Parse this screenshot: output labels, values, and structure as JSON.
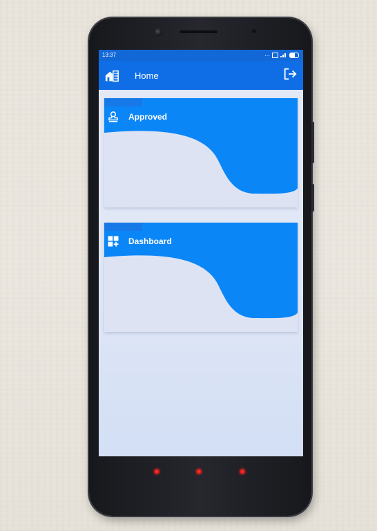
{
  "status_bar": {
    "time": "13:37",
    "icons": [
      "dots-icon",
      "sim-icon",
      "signal-icon",
      "battery-icon"
    ]
  },
  "app_bar": {
    "title": "Home",
    "left_icon": "home-icon",
    "right_icon": "logout-icon",
    "color": "#0f6ee5"
  },
  "cards": [
    {
      "label": "Approved",
      "icon": "stamp-icon"
    },
    {
      "label": "Dashboard",
      "icon": "dashboard-add-icon"
    }
  ],
  "theme": {
    "accent": "#0a7ef7",
    "indicator": "#e02020"
  }
}
